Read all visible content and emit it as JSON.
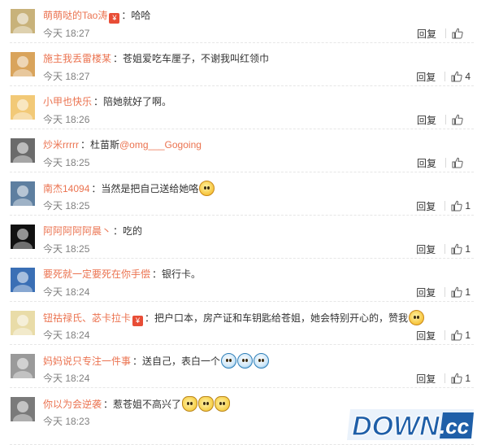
{
  "comments": [
    {
      "username": "萌萌哒的Tao涛",
      "badge": "red-envelope-icon",
      "text": "：哈哈",
      "time": "今天 18:27",
      "reply": "回复",
      "likes": "",
      "avatar_color": "#c8b27a"
    },
    {
      "username": "施主我丢雷楼某",
      "text": "：苍姐爱吃车厘子，不谢我叫红领巾",
      "time": "今天 18:27",
      "reply": "回复",
      "likes": "4",
      "avatar_color": "#d9a45c"
    },
    {
      "username": "小甲也快乐",
      "text": "：陪她就好了啊。",
      "time": "今天 18:26",
      "reply": "回复",
      "likes": "",
      "avatar_color": "#f2c977"
    },
    {
      "username": "炒米rrrrr",
      "text": "：杜苗斯",
      "mention": "@omg___Gogoing",
      "time": "今天 18:25",
      "reply": "回复",
      "likes": "",
      "avatar_color": "#6b6b6b"
    },
    {
      "username": "南杰14094",
      "text": "：当然是把自己送给她咯",
      "emojis": [
        "yellow"
      ],
      "time": "今天 18:25",
      "reply": "回复",
      "likes": "1",
      "avatar_color": "#5e7fa0"
    },
    {
      "username": "阿阿阿阿阿晨丶",
      "text": "：吃的",
      "time": "今天 18:25",
      "reply": "回复",
      "likes": "1",
      "avatar_color": "#111111"
    },
    {
      "username": "要死就一定要死在你手偿",
      "text": "：银行卡。",
      "time": "今天 18:24",
      "reply": "回复",
      "likes": "1",
      "avatar_color": "#3a6fb5"
    },
    {
      "username": "钮祜禄氏、苾卡拉卡",
      "badge": "red-envelope-icon",
      "text": "：把户口本，房产证和车钥匙给苍姐，她会特别开心的，赞我",
      "emojis": [
        "yellow"
      ],
      "time": "今天 18:24",
      "reply": "回复",
      "likes": "1",
      "avatar_color": "#e9dca8"
    },
    {
      "username": "妈妈说只专注一件事",
      "text": "：送自己，表白一个",
      "emojis": [
        "blue",
        "blue",
        "blue"
      ],
      "time": "今天 18:24",
      "reply": "回复",
      "likes": "1",
      "avatar_color": "#9a9a9a"
    },
    {
      "username": "你以为会逆袭",
      "text": "：惹苍姐不高兴了",
      "emojis": [
        "cat",
        "cat",
        "cat"
      ],
      "time": "今天 18:23",
      "reply": "回复",
      "likes": "",
      "avatar_color": "#7a7a7a"
    }
  ],
  "watermark": {
    "text_main": "DOWN",
    "text_suffix": ".cc"
  },
  "colors": {
    "username": "#eb7350",
    "time": "#808080",
    "text": "#333333"
  }
}
